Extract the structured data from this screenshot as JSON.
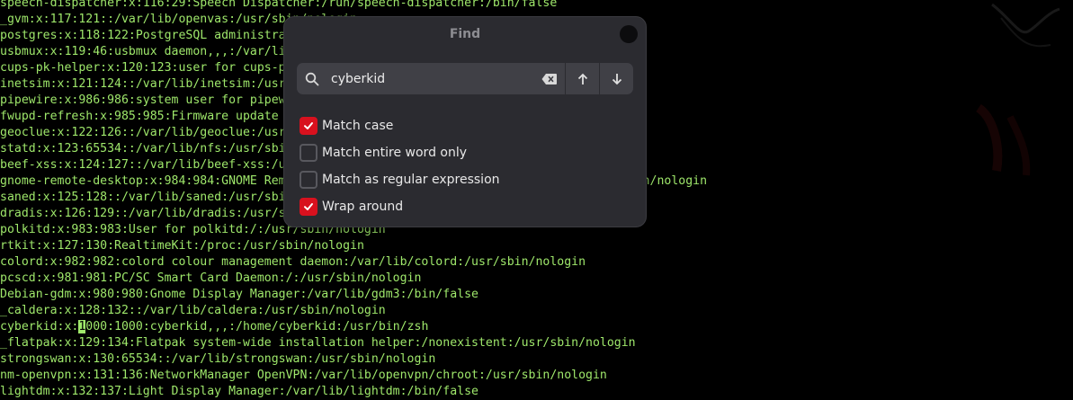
{
  "terminal": {
    "lines": [
      "speech-dispatcher:x:116:29:Speech Dispatcher:/run/speech-dispatcher:/bin/false",
      "_gvm:x:117:121::/var/lib/openvas:/usr/sbin/nologin",
      "postgres:x:118:122:PostgreSQL administrator,,,:/var/lib/postgresql:/bin/bash",
      "usbmux:x:119:46:usbmux daemon,,,:/var/lib/usbmux:/usr/sbin/nologin",
      "cups-pk-helper:x:120:123:user for cups-pk-helper service,,,:/nonexistent:/usr/sbin/nologin",
      "inetsim:x:121:124::/var/lib/inetsim:/usr/sbin/nologin",
      "pipewire:x:986:986:system user for pipewire:/var/lib/pipewire:/usr/sbin/nologin",
      "fwupd-refresh:x:985:985:Firmware update daemon:/var/lib/fwupd:/usr/sbin/nologin",
      "geoclue:x:122:126::/var/lib/geoclue:/usr/sbin/nologin",
      "statd:x:123:65534::/var/lib/nfs:/usr/sbin/nologin",
      "beef-xss:x:124:127::/var/lib/beef-xss:/usr/sbin/nologin",
      "gnome-remote-desktop:x:984:984:GNOME Remote Desktop:/var/lib/gnome-remote-desktop:/usr/sbin/nologin",
      "saned:x:125:128::/var/lib/saned:/usr/sbin/nologin",
      "dradis:x:126:129::/var/lib/dradis:/usr/sbin/nologin",
      "polkitd:x:983:983:User for polkitd:/:/usr/sbin/nologin",
      "rtkit:x:127:130:RealtimeKit:/proc:/usr/sbin/nologin",
      "colord:x:982:982:colord colour management daemon:/var/lib/colord:/usr/sbin/nologin",
      "pcscd:x:981:981:PC/SC Smart Card Daemon:/:/usr/sbin/nologin",
      "Debian-gdm:x:980:980:Gnome Display Manager:/var/lib/gdm3:/bin/false",
      "_caldera:x:128:132::/var/lib/caldera:/usr/sbin/nologin",
      "cyberkid:x:1000:1000:cyberkid,,,:/home/cyberkid:/usr/bin/zsh",
      "_flatpak:x:129:134:Flatpak system-wide installation helper:/nonexistent:/usr/sbin/nologin",
      "strongswan:x:130:65534::/var/lib/strongswan:/usr/sbin/nologin",
      "nm-openvpn:x:131:136:NetworkManager OpenVPN:/var/lib/openvpn/chroot:/usr/sbin/nologin",
      "lightdm:x:132:137:Light Display Manager:/var/lib/lightdm:/bin/false"
    ],
    "cursor": {
      "line": 20,
      "col": 11
    }
  },
  "find_dialog": {
    "title": "Find",
    "search_value": "cyberkid",
    "icons": {
      "search": "search-icon",
      "clear": "backspace-clear-icon",
      "previous": "arrow-up-icon",
      "next": "arrow-down-icon",
      "close": "close-icon"
    },
    "options": [
      {
        "label": "Match case",
        "checked": true
      },
      {
        "label": "Match entire word only",
        "checked": false
      },
      {
        "label": "Match as regular expression",
        "checked": false
      },
      {
        "label": "Wrap around",
        "checked": true
      }
    ]
  },
  "colors": {
    "terminal_text": "#9fe86b",
    "dialog_bg": "#2b2b30",
    "accent_checked": "#d8111e"
  }
}
